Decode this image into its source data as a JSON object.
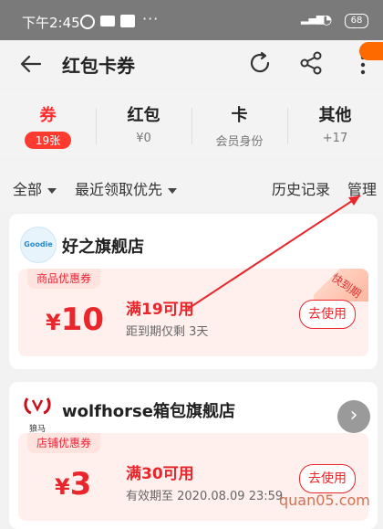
{
  "status": {
    "time": "下午2:45",
    "dots": "···",
    "battery": "68"
  },
  "nav": {
    "title": "红包卡券"
  },
  "tabs": [
    {
      "t1": "券",
      "t2": "19张"
    },
    {
      "t1": "红包",
      "t2": "¥0"
    },
    {
      "t1": "卡",
      "t2": "会员身份"
    },
    {
      "t1": "其他",
      "t2": "+17"
    }
  ],
  "filters": {
    "all": "全部",
    "sort": "最近领取优先",
    "history": "历史记录",
    "manage": "管理"
  },
  "cards": [
    {
      "store": "好之旗舰店",
      "logo_text": "Goodie",
      "tag": "商品优惠券",
      "currency": "¥",
      "amount": "10",
      "condition": "满19可用",
      "sub": "距到期仅剩 3天",
      "button": "去使用",
      "ribbon": "快到期"
    },
    {
      "store": "wolfhorse箱包旗舰店",
      "logo_text": "狼马",
      "tag": "店铺优惠券",
      "currency": "¥",
      "amount": "3",
      "condition": "满30可用",
      "sub": "有效期至 2020.08.09 23:59",
      "button": "去使用"
    }
  ],
  "watermark": "quan05.com",
  "colors": {
    "accent": "#e8262b",
    "badge": "#ff6a00"
  }
}
